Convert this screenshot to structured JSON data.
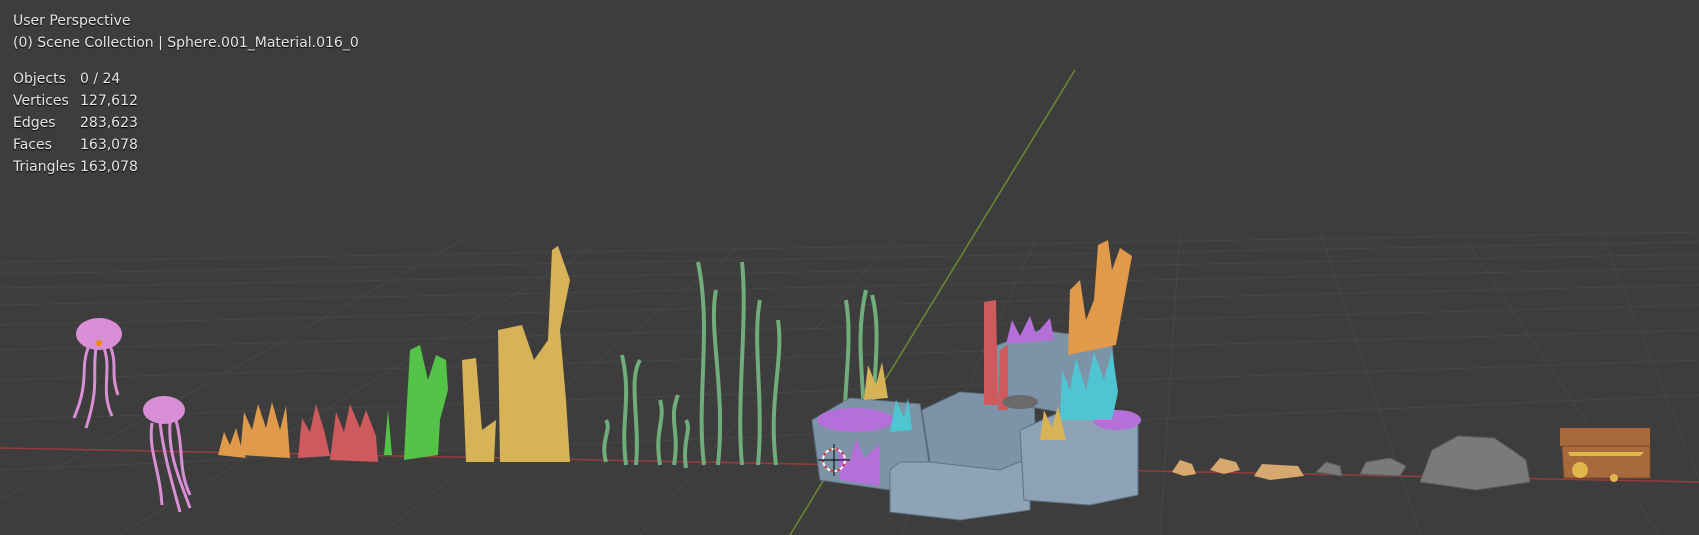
{
  "viewport": {
    "view_name": "User Perspective",
    "context_line": "(0) Scene Collection | Sphere.001_Material.016_0",
    "stats": [
      {
        "label": "Objects",
        "value": "0 / 24"
      },
      {
        "label": "Vertices",
        "value": "127,612"
      },
      {
        "label": "Edges",
        "value": "283,623"
      },
      {
        "label": "Faces",
        "value": "163,078"
      },
      {
        "label": "Triangles",
        "value": "163,078"
      }
    ]
  },
  "colors": {
    "background": "#3d3d3d",
    "grid": "#474747",
    "x_axis": "#9a3b3b",
    "y_axis": "#6a8a30",
    "jellyfish": "#d98fd6",
    "coral_orange": "#e09a4a",
    "coral_red": "#cf5a5e",
    "coral_green": "#55c248",
    "kelp_yellow": "#d8b257",
    "seaweed_green": "#6fae7a",
    "rock_blue": "#7d93a8",
    "anemone_purple": "#b46fd9",
    "cyan": "#4fc5d1",
    "stone_grey": "#7a7a7a",
    "pebble": "#d6a76f",
    "chest_wood": "#a86a3c",
    "chest_gold": "#e1b64a"
  }
}
